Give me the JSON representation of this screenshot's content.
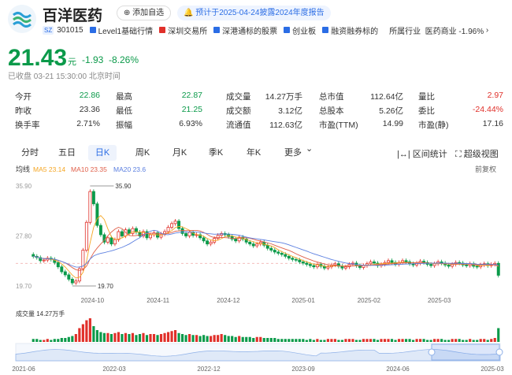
{
  "header": {
    "stock_name": "百洋医药",
    "add_watch": "添加自选",
    "notice": "预计于2025-04-24披露2024年度报告",
    "market_code": "SZ",
    "stock_code": "301015",
    "tags": [
      "Level1基础行情",
      "深圳交易所",
      "深港通标的股票",
      "创业板",
      "融资融券标的"
    ],
    "industry_label": "所属行业",
    "industry_value": "医药商业 -1.96%"
  },
  "quote": {
    "price": "21.43",
    "unit": "元",
    "change": "-1.93",
    "change_pct": "-8.26%",
    "status": "已收盘 03-21 15:30:00 北京时间"
  },
  "stats": [
    [
      {
        "label": "今开",
        "value": "22.86"
      },
      {
        "label": "最高",
        "value": "22.87"
      },
      {
        "label": "成交量",
        "value": "14.27万手"
      },
      {
        "label": "总市值",
        "value": "112.64亿"
      },
      {
        "label": "量比",
        "value": "2.97"
      }
    ],
    [
      {
        "label": "昨收",
        "value": "23.36"
      },
      {
        "label": "最低",
        "value": "21.25"
      },
      {
        "label": "成交额",
        "value": "3.12亿"
      },
      {
        "label": "总股本",
        "value": "5.26亿"
      },
      {
        "label": "委比",
        "value": "-24.44%"
      }
    ],
    [
      {
        "label": "换手率",
        "value": "2.71%"
      },
      {
        "label": "振幅",
        "value": "6.93%"
      },
      {
        "label": "流通值",
        "value": "112.63亿"
      },
      {
        "label": "市盈(TTM)",
        "value": "14.99"
      },
      {
        "label": "市盈(静)",
        "value": "17.16"
      }
    ]
  ],
  "tabs": [
    "分时",
    "五日",
    "日K",
    "周K",
    "月K",
    "季K",
    "年K",
    "更多"
  ],
  "active_tab": "日K",
  "tools": {
    "interval_stats": "区间统计",
    "super_view": "超级视图"
  },
  "chart_labels": {
    "ma_title": "均线",
    "ma5": "MA5 23.14",
    "ma10": "MA10 23.35",
    "ma20": "MA20 23.6",
    "adjust": "前复权",
    "y_top": "35.90",
    "y_mid": "27.80",
    "y_bottom": "19.70",
    "high_mark": "35.90",
    "low_mark": "19.70",
    "x_dates": [
      "2024-10",
      "2024-11",
      "2024-12",
      "2025-01",
      "2025-02",
      "2025-03"
    ],
    "volume_title": "成交量 14.27万手",
    "overview_dates": [
      "2021-06",
      "2022-03",
      "2022-12",
      "2023-09",
      "2024-06",
      "2025-03"
    ]
  },
  "colors": {
    "up": "#e0302a",
    "down": "#0b9a4a",
    "accent": "#2b6de5",
    "ma5": "#f5a623",
    "ma10": "#e0604a",
    "ma20": "#5b7fe0"
  },
  "chart_data": {
    "type": "candlestick",
    "ylim": [
      19.7,
      35.9
    ],
    "annotations": {
      "high": 35.9,
      "low": 19.7
    },
    "close_approx": [
      24.5,
      24.3,
      23.8,
      23.9,
      24.2,
      24.0,
      23.5,
      22.8,
      22.0,
      21.5,
      20.8,
      20.2,
      20.5,
      22.5,
      25.5,
      30.0,
      35.0,
      33.0,
      29.5,
      28.0,
      26.8,
      27.5,
      26.5,
      27.2,
      28.5,
      27.8,
      28.8,
      28.2,
      29.0,
      28.4,
      27.8,
      28.5,
      27.5,
      28.0,
      28.3,
      27.6,
      28.1,
      28.5,
      29.2,
      29.8,
      30.2,
      29.0,
      28.2,
      27.8,
      28.4,
      27.9,
      28.0,
      27.5,
      27.0,
      26.5,
      26.8,
      27.4,
      27.9,
      28.2,
      28.0,
      27.7,
      27.3,
      27.0,
      27.6,
      27.3,
      26.8,
      26.5,
      26.2,
      26.5,
      26.8,
      26.3,
      25.8,
      25.5,
      25.2,
      25.0,
      24.8,
      24.5,
      24.2,
      24.0,
      23.9,
      23.6,
      23.4,
      23.2,
      23.0,
      22.8,
      23.2,
      22.9,
      22.6,
      22.8,
      23.1,
      23.3,
      22.9,
      22.6,
      22.8,
      23.2,
      23.4,
      23.0,
      22.7,
      23.0,
      23.3,
      23.6,
      23.4,
      23.0,
      23.2,
      23.5,
      23.8,
      23.5,
      23.2,
      23.5,
      23.8,
      23.6,
      23.3,
      23.1,
      23.4,
      23.7,
      23.5,
      23.2,
      23.0,
      23.3,
      23.6,
      23.4,
      23.1,
      22.9,
      23.2,
      23.5,
      23.4,
      23.1,
      23.0,
      23.3,
      22.9,
      22.8,
      23.1,
      23.3,
      23.0,
      23.2,
      23.36,
      21.43
    ],
    "volume_approx": [
      3,
      3,
      2,
      2,
      3,
      2,
      3,
      3,
      4,
      4,
      5,
      6,
      8,
      14,
      18,
      22,
      24,
      16,
      12,
      10,
      9,
      9,
      8,
      9,
      10,
      8,
      9,
      8,
      9,
      7,
      8,
      9,
      7,
      8,
      8,
      7,
      8,
      9,
      10,
      11,
      12,
      9,
      8,
      7,
      8,
      7,
      7,
      6,
      7,
      6,
      6,
      7,
      7,
      8,
      7,
      6,
      6,
      5,
      6,
      5,
      5,
      5,
      4,
      5,
      5,
      4,
      4,
      4,
      4,
      3,
      3,
      3,
      3,
      3,
      3,
      3,
      3,
      2,
      3,
      2,
      3,
      2,
      2,
      3,
      3,
      3,
      2,
      2,
      3,
      3,
      3,
      2,
      2,
      3,
      3,
      3,
      3,
      2,
      3,
      3,
      3,
      3,
      2,
      3,
      3,
      3,
      3,
      2,
      3,
      3,
      3,
      2,
      2,
      3,
      3,
      3,
      2,
      2,
      3,
      3,
      3,
      2,
      2,
      3,
      2,
      2,
      3,
      3,
      2,
      3,
      4,
      14
    ]
  }
}
